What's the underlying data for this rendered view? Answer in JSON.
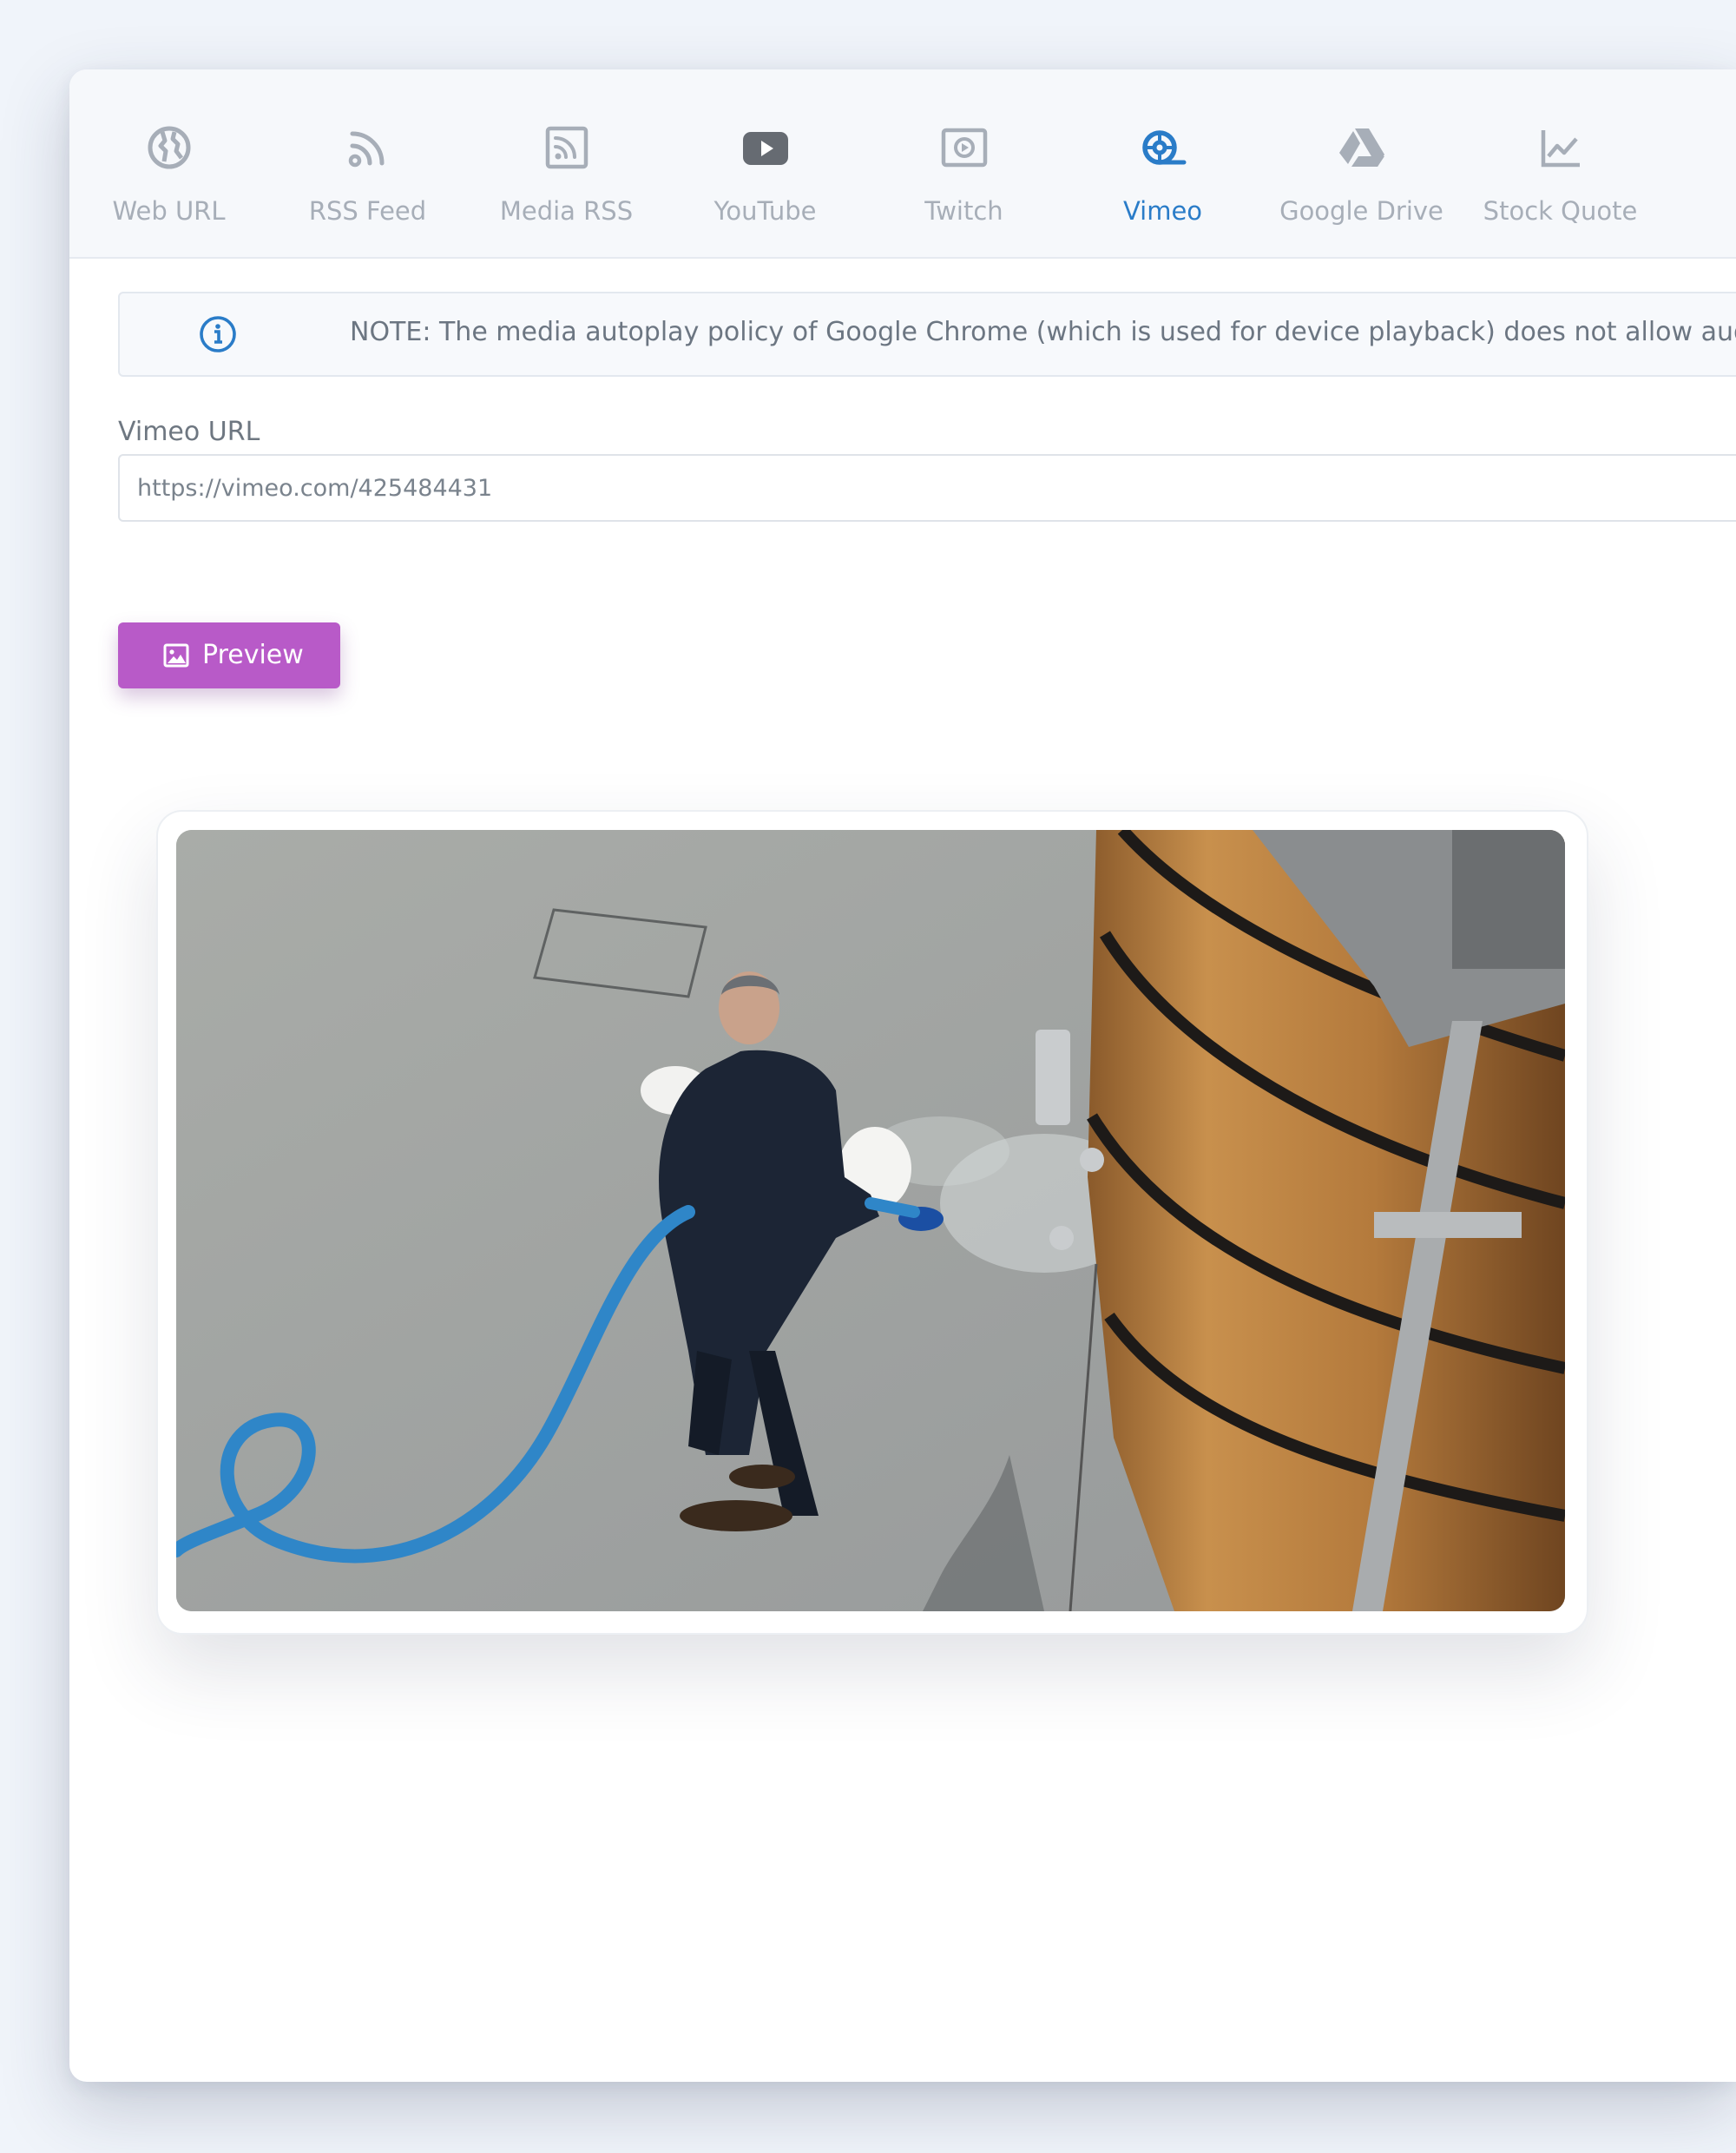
{
  "tabs": [
    {
      "label": "Web URL",
      "icon": "globe-icon",
      "active": false
    },
    {
      "label": "RSS Feed",
      "icon": "rss-icon",
      "active": false
    },
    {
      "label": "Media RSS",
      "icon": "media-rss-icon",
      "active": false
    },
    {
      "label": "YouTube",
      "icon": "youtube-icon",
      "active": false
    },
    {
      "label": "Twitch",
      "icon": "twitch-icon",
      "active": false
    },
    {
      "label": "Vimeo",
      "icon": "vimeo-icon",
      "active": true
    },
    {
      "label": "Google Drive",
      "icon": "google-drive-icon",
      "active": false
    },
    {
      "label": "Stock Quote",
      "icon": "stock-chart-icon",
      "active": false
    }
  ],
  "notice": {
    "icon": "info-icon",
    "text": "NOTE: The media autoplay policy of Google Chrome (which is used for device playback) does not allow audio playback"
  },
  "form": {
    "url_label": "Vimeo URL",
    "url_value": "https://vimeo.com/425484431"
  },
  "preview_button": {
    "label": "Preview",
    "icon": "image-icon"
  },
  "colors": {
    "active_tab": "#2a7cc8",
    "inactive_tab": "#a7aeb8",
    "preview_button": "#b85ac8",
    "info_icon": "#2a7cc8"
  }
}
